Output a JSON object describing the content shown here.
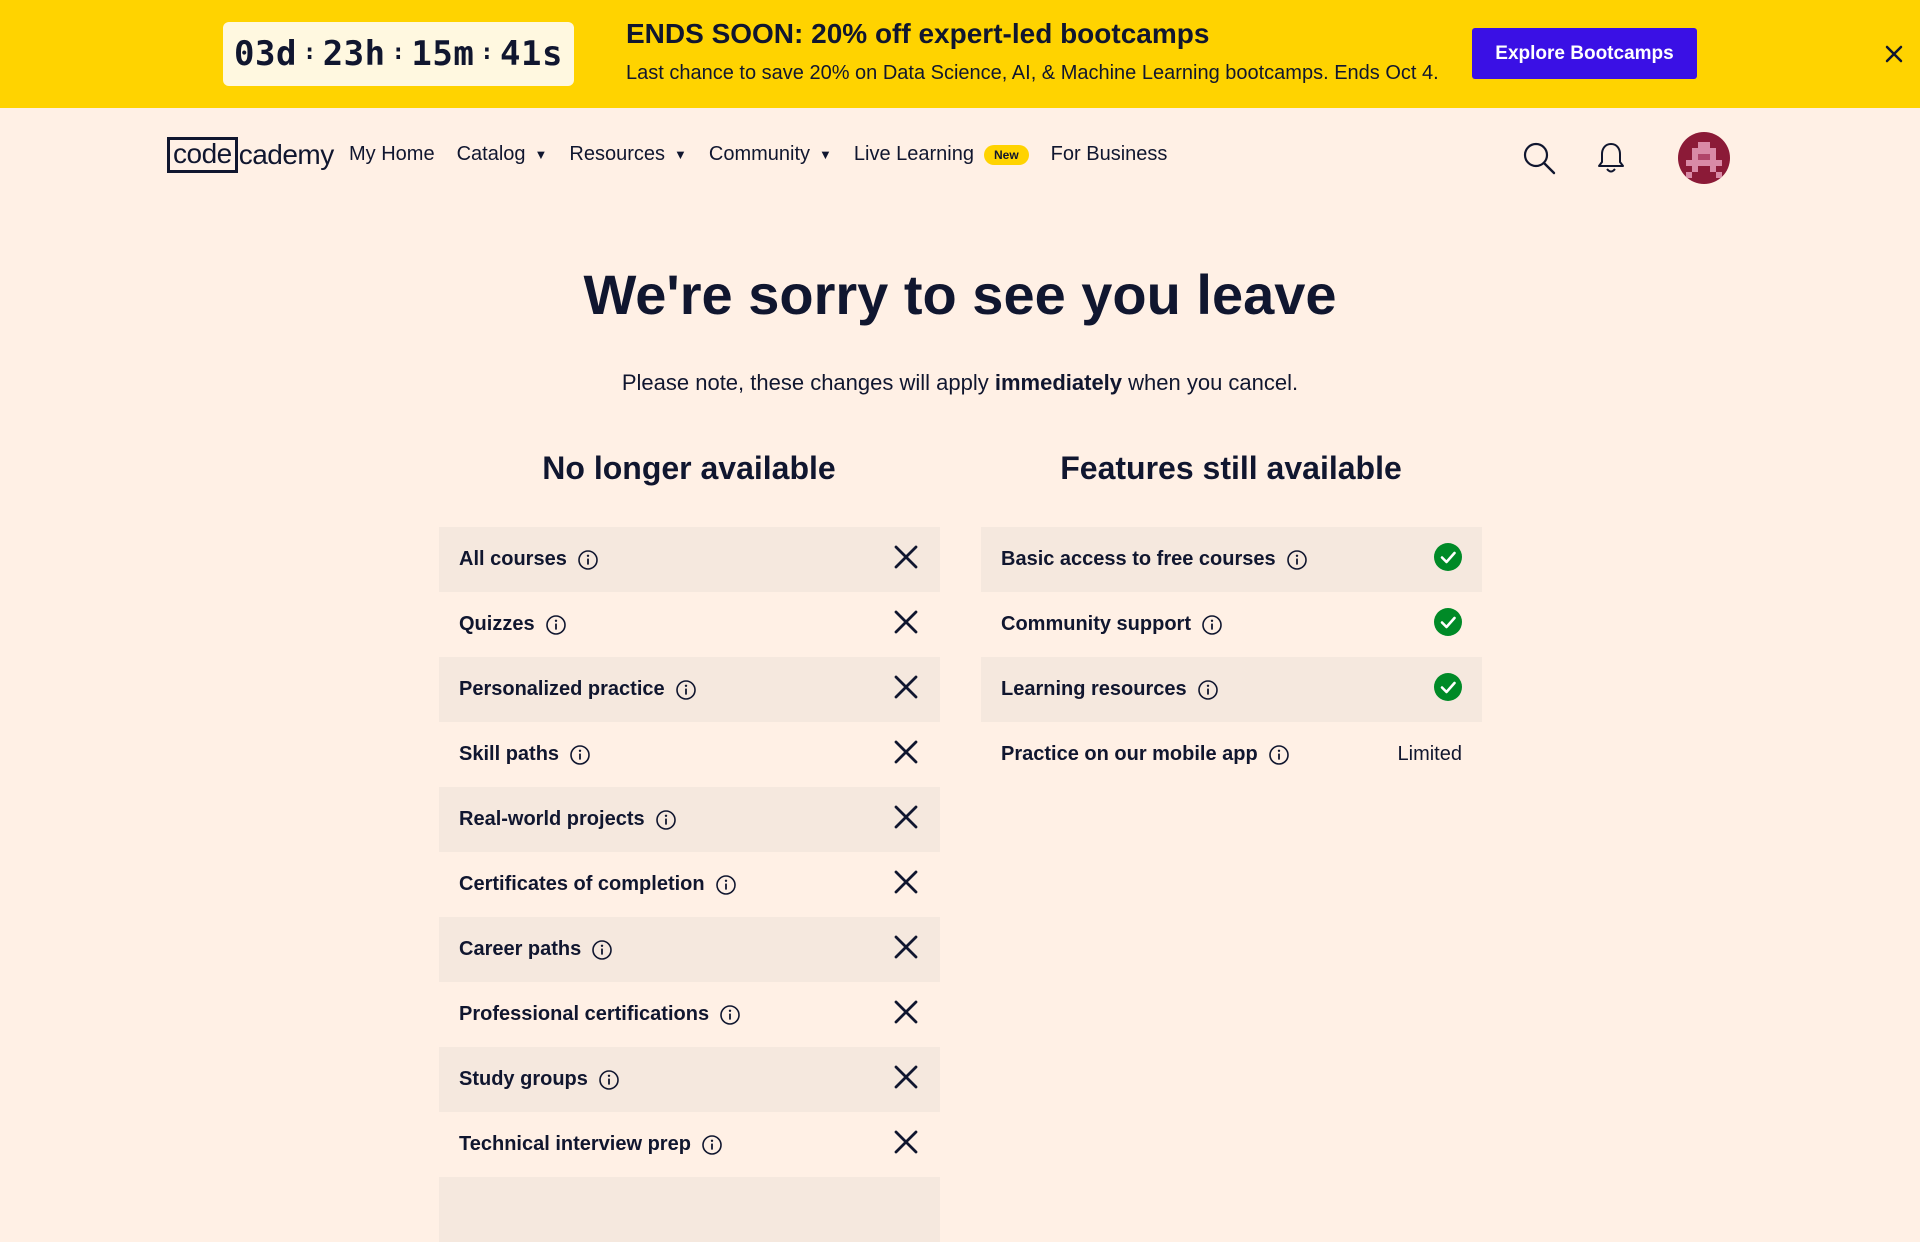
{
  "banner": {
    "countdown": {
      "days": "03d",
      "hours": "23h",
      "minutes": "15m",
      "seconds": "41s",
      "separator": ":"
    },
    "title": "ENDS SOON: 20% off expert-led bootcamps",
    "subtitle": "Last chance to save 20% on Data Science, AI, & Machine Learning bootcamps. Ends Oct 4.",
    "button_label": "Explore Bootcamps",
    "close_icon": "close-icon"
  },
  "nav": {
    "logo_box": "code",
    "logo_rest": "cademy",
    "links": [
      {
        "label": "My Home",
        "has_dropdown": false
      },
      {
        "label": "Catalog",
        "has_dropdown": true
      },
      {
        "label": "Resources",
        "has_dropdown": true
      },
      {
        "label": "Community",
        "has_dropdown": true
      },
      {
        "label": "Live Learning",
        "has_dropdown": false,
        "badge": "New"
      },
      {
        "label": "For Business",
        "has_dropdown": false
      }
    ],
    "dropdown_glyph": "▼",
    "icons": [
      "search-icon",
      "bell-icon",
      "avatar"
    ]
  },
  "main": {
    "title": "We're sorry to see you leave",
    "subtitle_pre": "Please note, these changes will apply ",
    "subtitle_bold": "immediately",
    "subtitle_post": " when you cancel.",
    "unavailable": {
      "heading": "No longer available",
      "items": [
        "All courses",
        "Quizzes",
        "Personalized practice",
        "Skill paths",
        "Real-world projects",
        "Certificates of completion",
        "Career paths",
        "Professional certifications",
        "Study groups",
        "Technical interview prep"
      ]
    },
    "available": {
      "heading": "Features still available",
      "items": [
        {
          "label": "Basic access to free courses",
          "status": "check"
        },
        {
          "label": "Community support",
          "status": "check"
        },
        {
          "label": "Learning resources",
          "status": "check"
        },
        {
          "label": "Practice on our mobile app",
          "status": "text",
          "status_text": "Limited"
        }
      ]
    }
  },
  "colors": {
    "banner_bg": "#ffd300",
    "page_bg": "#fff0e5",
    "row_alt_bg": "#f5e8de",
    "primary_button": "#3a10e5",
    "text": "#10162f",
    "check_green": "#008a27",
    "avatar_bg": "#8b1a37"
  }
}
